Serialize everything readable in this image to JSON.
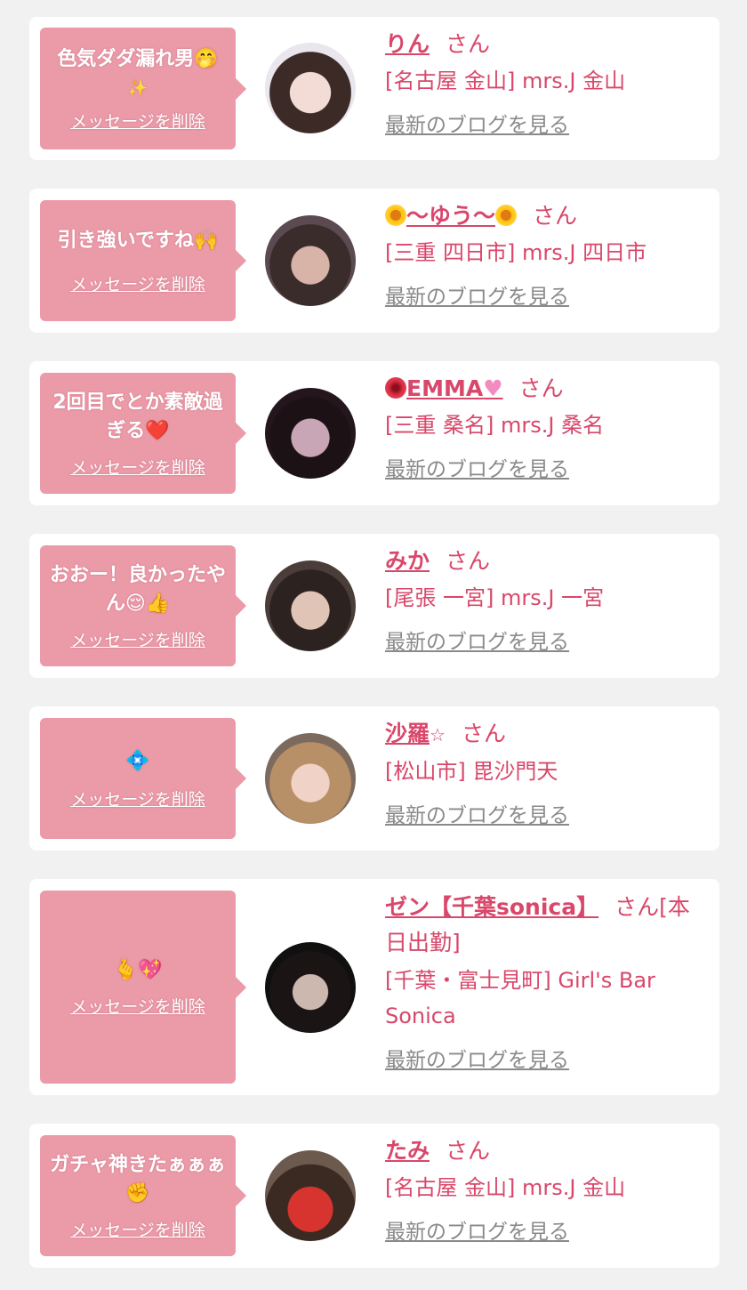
{
  "items": [
    {
      "message": "色気ダダ漏れ男🤭",
      "message_line2": "✨",
      "delete_label": "メッセージを削除",
      "name": "りん",
      "honorific": "さん",
      "shop": "[名古屋 金山] mrs.J 金山",
      "blog_link": "最新のブログを見る",
      "avatar_icon": "avatar-photo"
    },
    {
      "message": "引き強いですね🙌",
      "delete_label": "メッセージを削除",
      "name": "〜ゆう〜",
      "honorific": "さん",
      "shop": "[三重 四日市] mrs.J 四日市",
      "blog_link": "最新のブログを見る",
      "avatar_icon": "avatar-photo"
    },
    {
      "message": "2回目でとか素敵過ぎる",
      "message_emoji": "❤️",
      "delete_label": "メッセージを削除",
      "name": "EMMA",
      "honorific": "さん",
      "shop": "[三重 桑名] mrs.J 桑名",
      "blog_link": "最新のブログを見る",
      "avatar_icon": "avatar-photo"
    },
    {
      "message": "おおー！良かったやん",
      "message_emoji": "😌👍",
      "delete_label": "メッセージを削除",
      "name": "みか",
      "honorific": "さん",
      "shop": "[尾張 一宮] mrs.J 一宮",
      "blog_link": "最新のブログを見る",
      "avatar_icon": "avatar-photo"
    },
    {
      "message": "💠",
      "delete_label": "メッセージを削除",
      "name": "沙羅",
      "name_suffix": "☆",
      "honorific": "さん",
      "shop": "[松山市] 毘沙門天",
      "blog_link": "最新のブログを見る",
      "avatar_icon": "avatar-photo"
    },
    {
      "message": "🫰💖",
      "delete_label": "メッセージを削除",
      "name": "ゼン【千葉sonica】",
      "honorific": "さん[本日出勤]",
      "shop": "[千葉・富士見町] Girl's Bar Sonica",
      "blog_link": "最新のブログを見る",
      "avatar_icon": "avatar-photo"
    },
    {
      "message": "ガチャ神きたぁぁぁ",
      "message_emoji": "✊",
      "delete_label": "メッセージを削除",
      "name": "たみ",
      "honorific": "さん",
      "shop": "[名古屋 金山] mrs.J 金山",
      "blog_link": "最新のブログを見る",
      "avatar_icon": "avatar-photo"
    }
  ],
  "colors": {
    "page_bg": "#f1f1f1",
    "card_bg": "#ffffff",
    "bubble_bg": "#eb9aa8",
    "accent": "#d9476a",
    "link_gray": "#8a8a8a"
  }
}
